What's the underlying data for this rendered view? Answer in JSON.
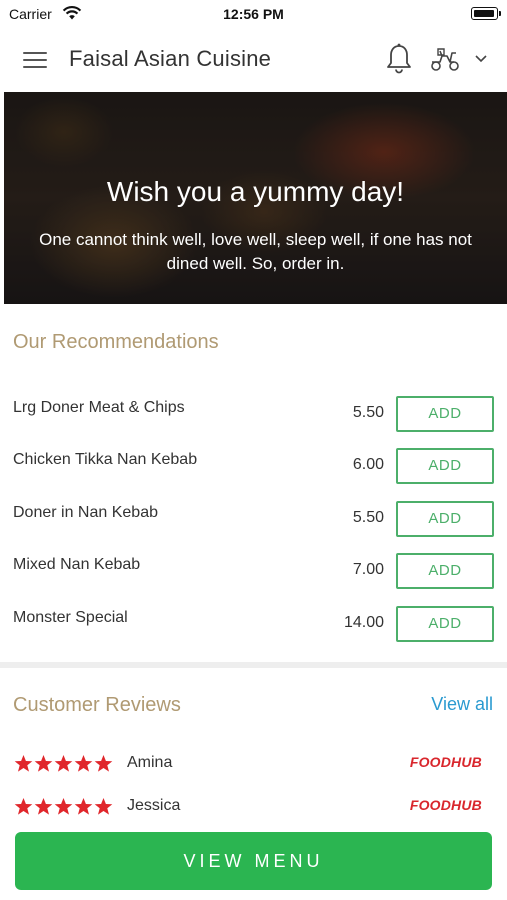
{
  "status_bar": {
    "carrier": "Carrier",
    "time": "12:56 PM"
  },
  "header": {
    "title": "Faisal Asian Cuisine",
    "icons": [
      "menu-icon",
      "bell-icon",
      "scooter-icon",
      "chevron-down-icon"
    ]
  },
  "hero": {
    "title": "Wish you a yummy day!",
    "subtitle": "One cannot think well, love well, sleep well, if one has not dined well. So, order in."
  },
  "recommendations": {
    "title": "Our Recommendations",
    "add_label": "ADD",
    "items": [
      {
        "name": "Lrg Doner Meat & Chips",
        "price": "5.50"
      },
      {
        "name": "Chicken Tikka Nan Kebab",
        "price": "6.00"
      },
      {
        "name": "Doner in Nan Kebab",
        "price": "5.50"
      },
      {
        "name": "Mixed Nan Kebab",
        "price": "7.00"
      },
      {
        "name": "Monster Special",
        "price": "14.00"
      }
    ]
  },
  "reviews": {
    "title": "Customer Reviews",
    "view_all": "View all",
    "items": [
      {
        "name": "Amina",
        "rating": 5,
        "source": "FOODHUB"
      },
      {
        "name": "Jessica",
        "rating": 5,
        "source": "FOODHUB"
      }
    ]
  },
  "cta": {
    "view_menu": "VIEW MENU"
  },
  "colors": {
    "accent_green": "#2bb551",
    "add_green": "#4caf6a",
    "section_title": "#b09a73",
    "link_blue": "#2a9ad0",
    "star_red": "#e0262b",
    "brand_red": "#d9262c"
  }
}
